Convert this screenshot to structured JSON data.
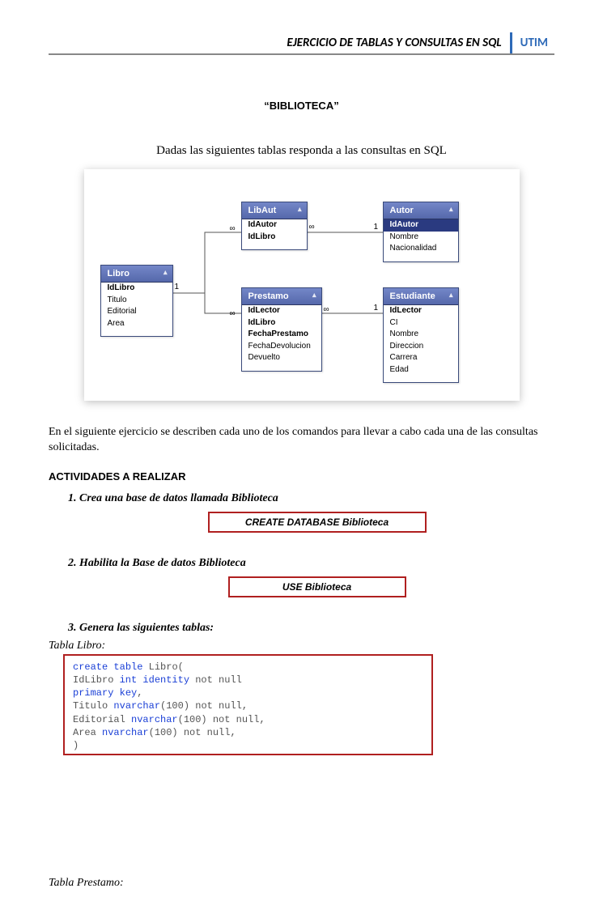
{
  "header": {
    "title": "EJERCICIO DE TABLAS Y CONSULTAS EN SQL",
    "badge": "UTIM"
  },
  "doc_title": "“BIBLIOTECA”",
  "intro": "Dadas las siguientes tablas responda a las consultas en SQL",
  "entities": {
    "libro": {
      "name": "Libro",
      "fields": [
        "IdLibro",
        "Titulo",
        "Editorial",
        "Area"
      ],
      "bold": [
        0
      ]
    },
    "libaut": {
      "name": "LibAut",
      "fields": [
        "IdAutor",
        "IdLibro"
      ],
      "bold": [
        0,
        1
      ]
    },
    "autor": {
      "name": "Autor",
      "fields": [
        "IdAutor",
        "Nombre",
        "Nacionalidad"
      ],
      "bold": [
        0
      ],
      "selected": 0
    },
    "prestamo": {
      "name": "Prestamo",
      "fields": [
        "IdLector",
        "IdLibro",
        "FechaPrestamo",
        "FechaDevolucion",
        "Devuelto"
      ],
      "bold": [
        0,
        1,
        2
      ]
    },
    "estudiante": {
      "name": "Estudiante",
      "fields": [
        "IdLector",
        "CI",
        "Nombre",
        "Direccion",
        "Carrera",
        "Edad"
      ],
      "bold": [
        0
      ]
    }
  },
  "rel_marks": {
    "libro_right_one": "1",
    "libaut_left_inf": "∞",
    "libaut_right_inf": "∞",
    "autor_left_one": "1",
    "prestamo_left_inf": "∞",
    "prestamo_right_inf": "∞",
    "estudiante_left_one": "1"
  },
  "desc_para": "En el siguiente ejercicio se describen cada uno de  los comandos para llevar a cabo cada una de las consultas solicitadas.",
  "activities_heading": "ACTIVIDADES A REALIZAR",
  "acts": {
    "a1": {
      "text": "Crea una base de datos llamada Biblioteca",
      "sql": "CREATE DATABASE Biblioteca"
    },
    "a2": {
      "text": "Habilita la Base de datos Biblioteca",
      "sql": "USE Biblioteca"
    },
    "a3": {
      "text": "Genera las siguientes tablas:"
    }
  },
  "tabla_libro_label": "Tabla Libro:",
  "code_libro": {
    "l1a": "create",
    "l1b": "table",
    "l1c": " Libro(",
    "l2a": "IdLibro ",
    "l2b": "int",
    "l2c": " ",
    "l2d": "identity",
    "l2e": " not null",
    "l3a": "primary",
    "l3b": " ",
    "l3c": "key",
    "l3d": ",",
    "l4a": "Titulo ",
    "l4b": "nvarchar",
    "l4c": "(100) not null,",
    "l5a": "Editorial ",
    "l5b": "nvarchar",
    "l5c": "(100) not null,",
    "l6a": "Area ",
    "l6b": "nvarchar",
    "l6c": "(100) not null,",
    "l7a": ")"
  },
  "tabla_prestamo_label": "Tabla Prestamo:"
}
